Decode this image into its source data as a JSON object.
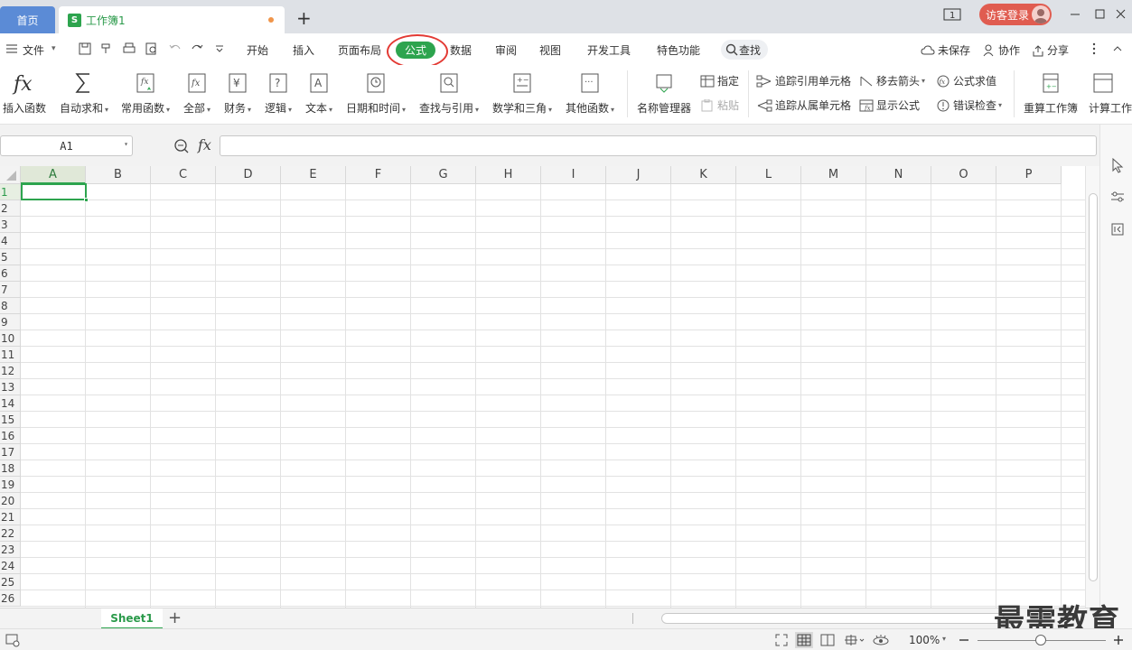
{
  "tabs": {
    "home": "首页",
    "doc": "工作簿1",
    "doc_icon": "S",
    "new": "+"
  },
  "login": {
    "label": "访客登录"
  },
  "menu": {
    "file": "文件",
    "items": [
      "开始",
      "插入",
      "页面布局",
      "公式",
      "数据",
      "审阅",
      "视图",
      "开发工具",
      "特色功能"
    ],
    "active": "公式",
    "search": "查找",
    "unsaved": "未保存",
    "collab": "协作",
    "share": "分享"
  },
  "ribbon": {
    "insert_fn": "插入函数",
    "autosum": "自动求和",
    "common": "常用函数",
    "all": "全部",
    "finance": "财务",
    "logic": "逻辑",
    "text": "文本",
    "datetime": "日期和时间",
    "lookup": "查找与引用",
    "math": "数学和三角",
    "other": "其他函数",
    "name_mgr": "名称管理器",
    "assign": "指定",
    "paste": "粘贴",
    "trace_prec": "追踪引用单元格",
    "trace_dep": "追踪从属单元格",
    "remove_arrows": "移去箭头",
    "show_formula": "显示公式",
    "eval_formula": "公式求值",
    "error_check": "错误检查",
    "recalc_book": "重算工作簿",
    "calc_options": "计算工作"
  },
  "formula_bar": {
    "name_box": "A1",
    "fx": "fx",
    "value": ""
  },
  "grid": {
    "columns": [
      "A",
      "B",
      "C",
      "D",
      "E",
      "F",
      "G",
      "H",
      "I",
      "J",
      "K",
      "L",
      "M",
      "N",
      "O",
      "P"
    ],
    "rows": [
      "1",
      "2",
      "3",
      "4",
      "5",
      "6",
      "7",
      "8",
      "9",
      "10",
      "11",
      "12",
      "13",
      "14",
      "15",
      "16",
      "17",
      "18",
      "19",
      "20",
      "21",
      "22",
      "23",
      "24",
      "25",
      "26"
    ],
    "selected_cell": "A1"
  },
  "sheets": {
    "tabs": [
      "Sheet1"
    ],
    "add": "+"
  },
  "status": {
    "zoom": "100%"
  },
  "watermark": "最需教育",
  "colors": {
    "accent": "#2da44e",
    "home_tab": "#5b8bd6",
    "login": "#e05c50",
    "highlight_ring": "#e33a34"
  }
}
